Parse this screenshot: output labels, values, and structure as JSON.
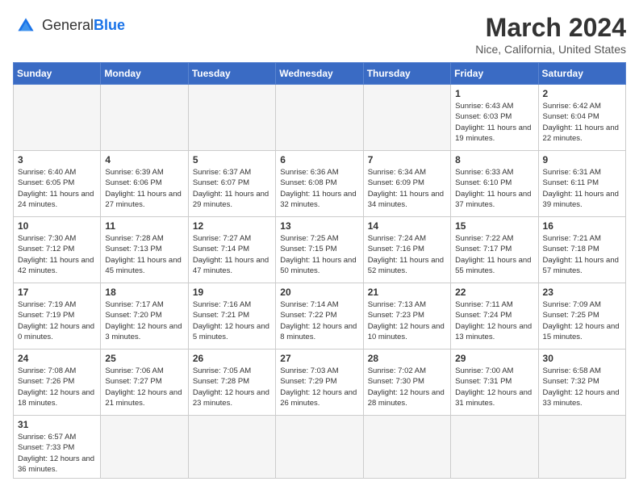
{
  "header": {
    "logo_general": "General",
    "logo_blue": "Blue",
    "month_title": "March 2024",
    "subtitle": "Nice, California, United States"
  },
  "weekdays": [
    "Sunday",
    "Monday",
    "Tuesday",
    "Wednesday",
    "Thursday",
    "Friday",
    "Saturday"
  ],
  "weeks": [
    [
      {
        "day": "",
        "info": ""
      },
      {
        "day": "",
        "info": ""
      },
      {
        "day": "",
        "info": ""
      },
      {
        "day": "",
        "info": ""
      },
      {
        "day": "",
        "info": ""
      },
      {
        "day": "1",
        "info": "Sunrise: 6:43 AM\nSunset: 6:03 PM\nDaylight: 11 hours and 19 minutes."
      },
      {
        "day": "2",
        "info": "Sunrise: 6:42 AM\nSunset: 6:04 PM\nDaylight: 11 hours and 22 minutes."
      }
    ],
    [
      {
        "day": "3",
        "info": "Sunrise: 6:40 AM\nSunset: 6:05 PM\nDaylight: 11 hours and 24 minutes."
      },
      {
        "day": "4",
        "info": "Sunrise: 6:39 AM\nSunset: 6:06 PM\nDaylight: 11 hours and 27 minutes."
      },
      {
        "day": "5",
        "info": "Sunrise: 6:37 AM\nSunset: 6:07 PM\nDaylight: 11 hours and 29 minutes."
      },
      {
        "day": "6",
        "info": "Sunrise: 6:36 AM\nSunset: 6:08 PM\nDaylight: 11 hours and 32 minutes."
      },
      {
        "day": "7",
        "info": "Sunrise: 6:34 AM\nSunset: 6:09 PM\nDaylight: 11 hours and 34 minutes."
      },
      {
        "day": "8",
        "info": "Sunrise: 6:33 AM\nSunset: 6:10 PM\nDaylight: 11 hours and 37 minutes."
      },
      {
        "day": "9",
        "info": "Sunrise: 6:31 AM\nSunset: 6:11 PM\nDaylight: 11 hours and 39 minutes."
      }
    ],
    [
      {
        "day": "10",
        "info": "Sunrise: 7:30 AM\nSunset: 7:12 PM\nDaylight: 11 hours and 42 minutes."
      },
      {
        "day": "11",
        "info": "Sunrise: 7:28 AM\nSunset: 7:13 PM\nDaylight: 11 hours and 45 minutes."
      },
      {
        "day": "12",
        "info": "Sunrise: 7:27 AM\nSunset: 7:14 PM\nDaylight: 11 hours and 47 minutes."
      },
      {
        "day": "13",
        "info": "Sunrise: 7:25 AM\nSunset: 7:15 PM\nDaylight: 11 hours and 50 minutes."
      },
      {
        "day": "14",
        "info": "Sunrise: 7:24 AM\nSunset: 7:16 PM\nDaylight: 11 hours and 52 minutes."
      },
      {
        "day": "15",
        "info": "Sunrise: 7:22 AM\nSunset: 7:17 PM\nDaylight: 11 hours and 55 minutes."
      },
      {
        "day": "16",
        "info": "Sunrise: 7:21 AM\nSunset: 7:18 PM\nDaylight: 11 hours and 57 minutes."
      }
    ],
    [
      {
        "day": "17",
        "info": "Sunrise: 7:19 AM\nSunset: 7:19 PM\nDaylight: 12 hours and 0 minutes."
      },
      {
        "day": "18",
        "info": "Sunrise: 7:17 AM\nSunset: 7:20 PM\nDaylight: 12 hours and 3 minutes."
      },
      {
        "day": "19",
        "info": "Sunrise: 7:16 AM\nSunset: 7:21 PM\nDaylight: 12 hours and 5 minutes."
      },
      {
        "day": "20",
        "info": "Sunrise: 7:14 AM\nSunset: 7:22 PM\nDaylight: 12 hours and 8 minutes."
      },
      {
        "day": "21",
        "info": "Sunrise: 7:13 AM\nSunset: 7:23 PM\nDaylight: 12 hours and 10 minutes."
      },
      {
        "day": "22",
        "info": "Sunrise: 7:11 AM\nSunset: 7:24 PM\nDaylight: 12 hours and 13 minutes."
      },
      {
        "day": "23",
        "info": "Sunrise: 7:09 AM\nSunset: 7:25 PM\nDaylight: 12 hours and 15 minutes."
      }
    ],
    [
      {
        "day": "24",
        "info": "Sunrise: 7:08 AM\nSunset: 7:26 PM\nDaylight: 12 hours and 18 minutes."
      },
      {
        "day": "25",
        "info": "Sunrise: 7:06 AM\nSunset: 7:27 PM\nDaylight: 12 hours and 21 minutes."
      },
      {
        "day": "26",
        "info": "Sunrise: 7:05 AM\nSunset: 7:28 PM\nDaylight: 12 hours and 23 minutes."
      },
      {
        "day": "27",
        "info": "Sunrise: 7:03 AM\nSunset: 7:29 PM\nDaylight: 12 hours and 26 minutes."
      },
      {
        "day": "28",
        "info": "Sunrise: 7:02 AM\nSunset: 7:30 PM\nDaylight: 12 hours and 28 minutes."
      },
      {
        "day": "29",
        "info": "Sunrise: 7:00 AM\nSunset: 7:31 PM\nDaylight: 12 hours and 31 minutes."
      },
      {
        "day": "30",
        "info": "Sunrise: 6:58 AM\nSunset: 7:32 PM\nDaylight: 12 hours and 33 minutes."
      }
    ],
    [
      {
        "day": "31",
        "info": "Sunrise: 6:57 AM\nSunset: 7:33 PM\nDaylight: 12 hours and 36 minutes."
      },
      {
        "day": "",
        "info": ""
      },
      {
        "day": "",
        "info": ""
      },
      {
        "day": "",
        "info": ""
      },
      {
        "day": "",
        "info": ""
      },
      {
        "day": "",
        "info": ""
      },
      {
        "day": "",
        "info": ""
      }
    ]
  ]
}
